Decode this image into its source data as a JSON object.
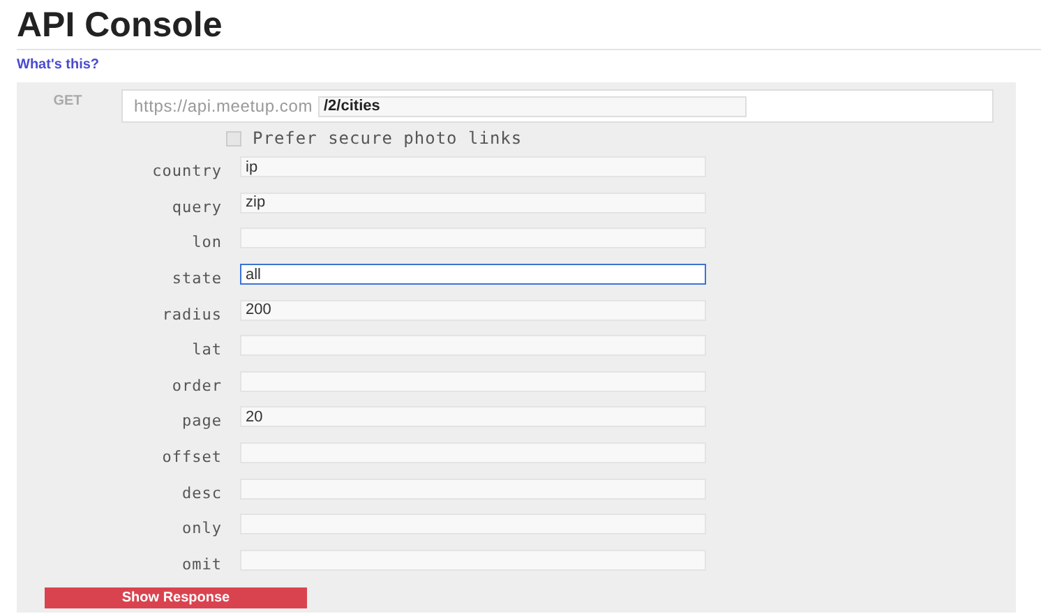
{
  "title": "API Console",
  "help_link": "What's this?",
  "request": {
    "method": "GET",
    "base_url": "https://api.meetup.com",
    "path": "/2/cities"
  },
  "secure_photos": {
    "label": "Prefer secure photo links",
    "checked": false
  },
  "params": [
    {
      "name": "country",
      "value": "ip",
      "focused": false
    },
    {
      "name": "query",
      "value": "zip",
      "focused": false
    },
    {
      "name": "lon",
      "focused": false
    },
    {
      "name": "state",
      "value": "all",
      "focused": true
    },
    {
      "name": "radius",
      "value": "200",
      "focused": false
    },
    {
      "name": "lat",
      "focused": false
    },
    {
      "name": "order",
      "focused": false
    },
    {
      "name": "page",
      "value": "20",
      "focused": false
    },
    {
      "name": "offset",
      "focused": false
    },
    {
      "name": "desc",
      "focused": false
    },
    {
      "name": "only",
      "focused": false
    },
    {
      "name": "omit",
      "focused": false
    }
  ],
  "submit": "Show Response"
}
